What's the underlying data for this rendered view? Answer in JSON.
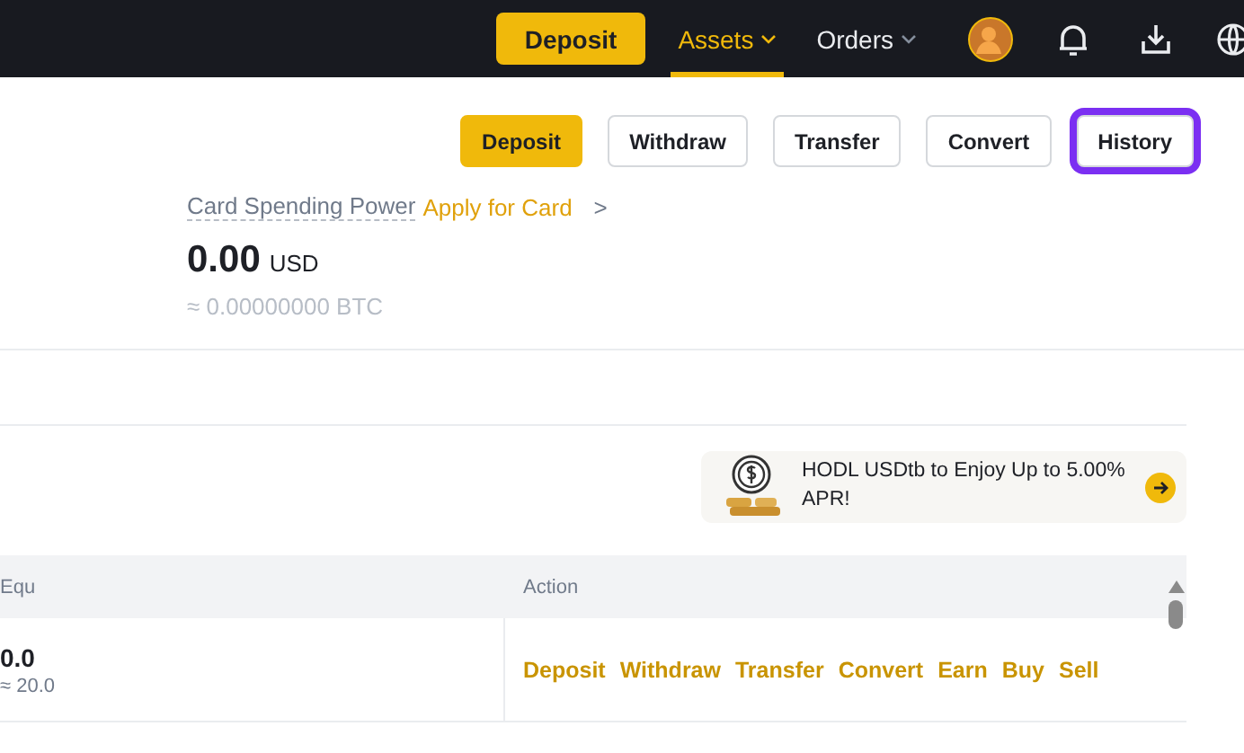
{
  "top_nav": {
    "deposit_button": "Deposit",
    "menus": [
      {
        "label": "Assets",
        "selected": true
      },
      {
        "label": "Orders",
        "selected": false
      }
    ]
  },
  "actions": [
    {
      "label": "Deposit",
      "kind": "primary",
      "highlighted": false
    },
    {
      "label": "Withdraw",
      "kind": "outline",
      "highlighted": false
    },
    {
      "label": "Transfer",
      "kind": "outline",
      "highlighted": false
    },
    {
      "label": "Convert",
      "kind": "outline",
      "highlighted": false
    },
    {
      "label": "History",
      "kind": "outline",
      "highlighted": true
    }
  ],
  "card": {
    "label": "Card Spending Power",
    "link": "Apply for Card",
    "chevron": ">"
  },
  "balance": {
    "amount": "0.00",
    "currency": "USD",
    "btc": "≈ 0.00000000 BTC"
  },
  "promo": {
    "text": "HODL USDtb to Enjoy Up to 5.00% APR!"
  },
  "table": {
    "columns": [
      "Equ",
      "Action"
    ],
    "rows": [
      {
        "equity": "0.0",
        "equity_approx": "≈ 20.0",
        "actions": [
          "Deposit",
          "Withdraw",
          "Transfer",
          "Convert",
          "Earn",
          "Buy",
          "Sell"
        ]
      }
    ]
  }
}
